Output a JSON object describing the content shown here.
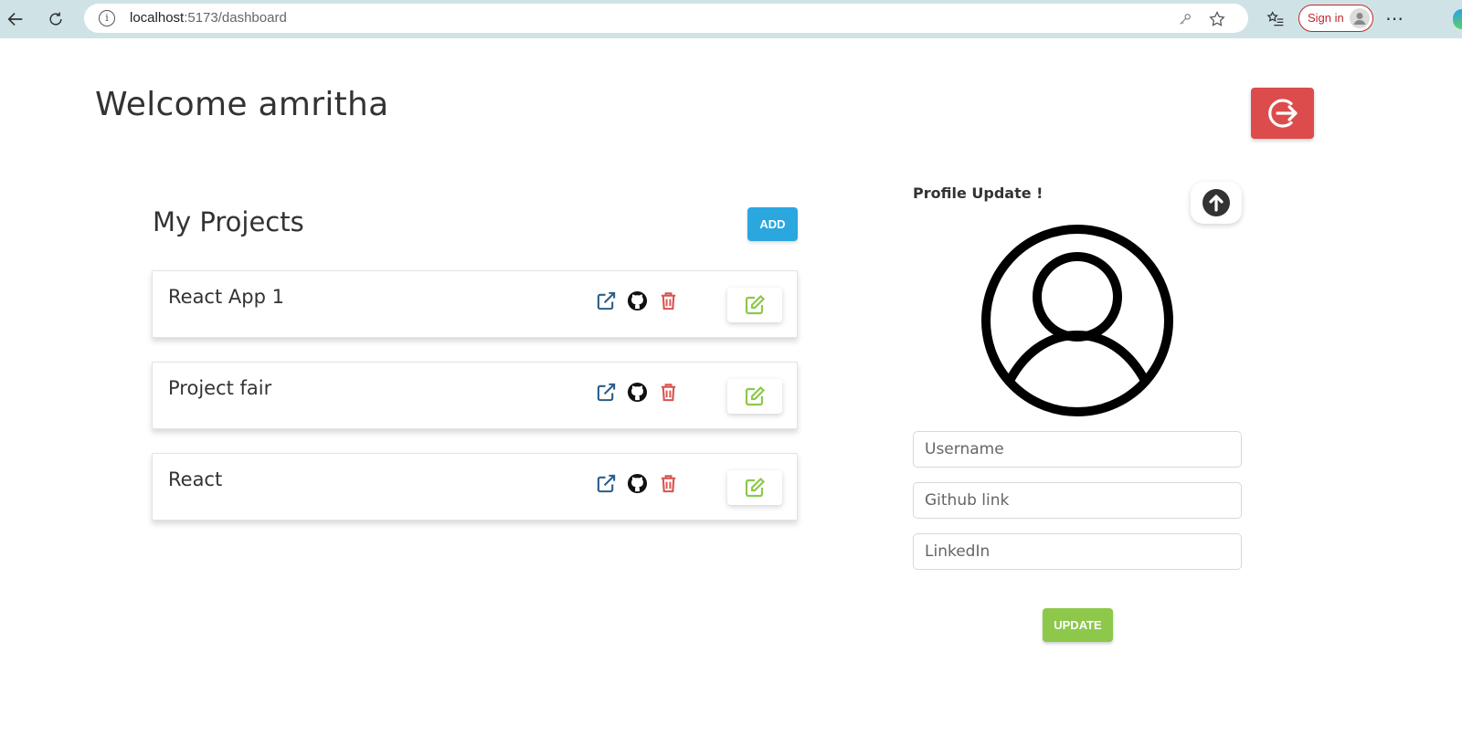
{
  "browser": {
    "url_host": "localhost",
    "url_path": ":5173/dashboard",
    "signin_label": "Sign in"
  },
  "header": {
    "welcome_text": "Welcome amritha"
  },
  "projects": {
    "title": "My Projects",
    "add_label": "ADD",
    "items": [
      {
        "name": "React App 1"
      },
      {
        "name": "Project fair"
      },
      {
        "name": "React"
      }
    ]
  },
  "profile": {
    "title": "Profile Update !",
    "username_placeholder": "Username",
    "github_placeholder": "Github link",
    "linkedin_placeholder": "LinkedIn",
    "update_label": "UPDATE"
  },
  "colors": {
    "logout": "#dc4c4c",
    "add": "#2aa7df",
    "update": "#8dc84b",
    "link_icon": "#2b5d8a",
    "delete_icon": "#d9534f",
    "edit_icon": "#8dc84b"
  }
}
